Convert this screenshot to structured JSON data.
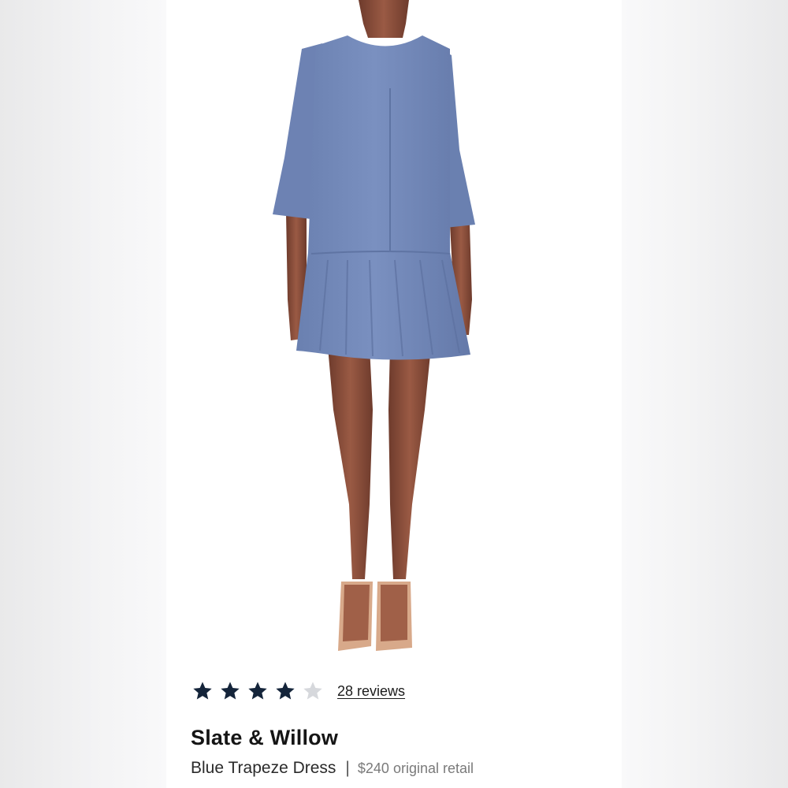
{
  "product": {
    "image_alt": "Blue Trapeze Dress",
    "dress_color": "#7288b8",
    "rating": {
      "value": 4,
      "max": 5,
      "filled_color": "#14243a",
      "empty_color": "#d6d8dc",
      "reviews_label": "28 reviews"
    },
    "brand": "Slate & Willow",
    "name": "Blue Trapeze Dress",
    "divider": "|",
    "price": "$240",
    "price_label": "original retail"
  }
}
